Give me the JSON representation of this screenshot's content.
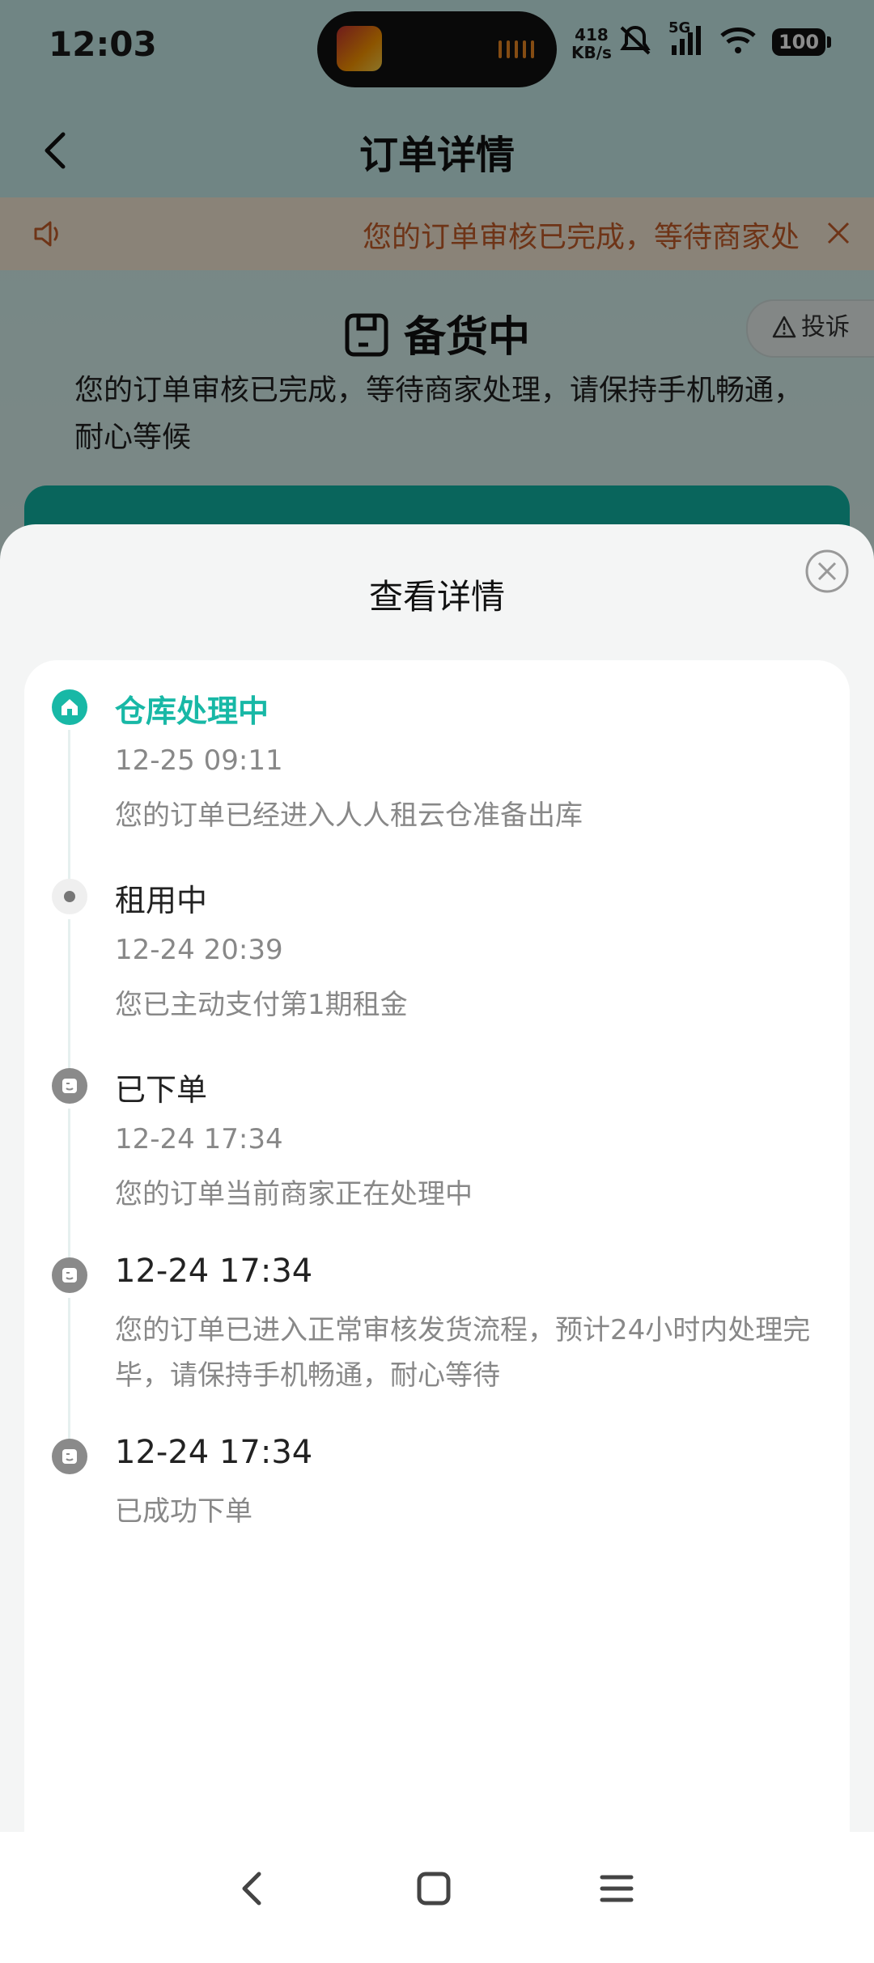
{
  "status_bar": {
    "time": "12:03",
    "speed_value": "418",
    "speed_unit": "KB/s",
    "network": "5G",
    "battery": "100",
    "icons": [
      "mute-icon",
      "signal-icon",
      "wifi-icon",
      "battery-icon"
    ]
  },
  "header": {
    "title": "订单详情"
  },
  "notice": {
    "text": "您的订单审核已完成，等待商家处"
  },
  "order_status": {
    "title": "备货中",
    "complaint_label": "投诉",
    "description": "您的订单审核已完成，等待商家处理，请保持手机畅通，耐心等候"
  },
  "sheet": {
    "title": "查看详情",
    "timeline": [
      {
        "title": "仓库处理中",
        "time": "12-25 09:11",
        "desc": "您的订单已经进入人人租云仓准备出库",
        "icon": "home-icon",
        "active": true
      },
      {
        "title": "租用中",
        "time": "12-24 20:39",
        "desc": "您已主动支付第1期租金",
        "icon": "dot-icon"
      },
      {
        "title": "已下单",
        "time": "12-24 17:34",
        "desc": "您的订单当前商家正在处理中",
        "icon": "note-icon"
      },
      {
        "title": "12-24 17:34",
        "desc": "您的订单已进入正常审核发货流程，预计24小时内处理完毕，请保持手机畅通，耐心等待",
        "icon": "note-icon"
      },
      {
        "title": "12-24 17:34",
        "desc": "已成功下单",
        "icon": "note-icon"
      }
    ]
  },
  "colors": {
    "accent": "#18b8a6",
    "notice_text": "#c8602a",
    "header_bg": "#cdf3f1"
  }
}
